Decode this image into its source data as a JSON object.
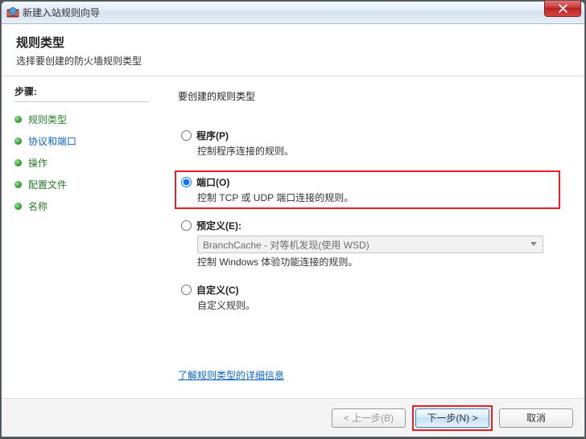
{
  "window": {
    "title": "新建入站规则向导"
  },
  "header": {
    "title": "规则类型",
    "subtitle": "选择要创建的防火墙规则类型"
  },
  "sidebar": {
    "steps_label": "步骤:",
    "items": [
      {
        "label": "规则类型",
        "current": true
      },
      {
        "label": "协议和端口",
        "link": true
      },
      {
        "label": "操作"
      },
      {
        "label": "配置文件"
      },
      {
        "label": "名称"
      }
    ]
  },
  "main": {
    "question": "要创建的规则类型",
    "options": [
      {
        "key": "program",
        "label": "程序(P)",
        "desc": "控制程序连接的规则。",
        "checked": false
      },
      {
        "key": "port",
        "label": "端口(O)",
        "desc": "控制 TCP 或 UDP 端口连接的规则。",
        "checked": true,
        "highlight": true
      },
      {
        "key": "predefined",
        "label": "预定义(E):",
        "desc": "控制 Windows 体验功能连接的规则。",
        "checked": false,
        "combo_value": "BranchCache - 对等机发现(使用 WSD)",
        "combo_enabled": false
      },
      {
        "key": "custom",
        "label": "自定义(C)",
        "desc": "自定义规则。",
        "checked": false
      }
    ],
    "learn_more": "了解规则类型的详细信息"
  },
  "footer": {
    "back": "< 上一步(B)",
    "next": "下一步(N) >",
    "cancel": "取消",
    "back_enabled": false,
    "next_highlight": true
  }
}
